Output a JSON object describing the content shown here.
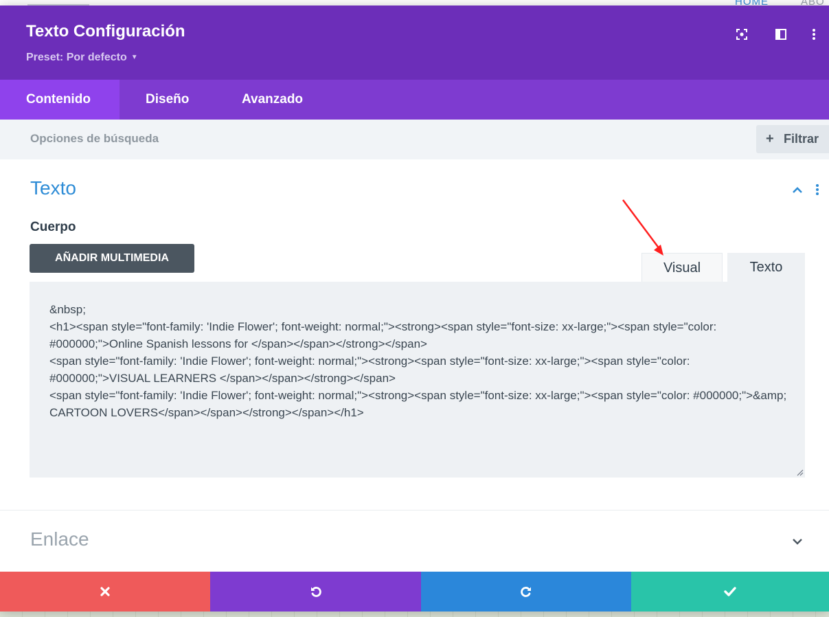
{
  "background": {
    "nav_home": "HOME",
    "nav_about": "ABO"
  },
  "header": {
    "title": "Texto Configuración",
    "preset": "Preset: Por defecto"
  },
  "tabs": [
    {
      "label": "Contenido",
      "active": true
    },
    {
      "label": "Diseño",
      "active": false
    },
    {
      "label": "Avanzado",
      "active": false
    }
  ],
  "search": {
    "placeholder": "Opciones de búsqueda",
    "filter_label": "Filtrar"
  },
  "section_texto": {
    "title": "Texto",
    "field_label": "Cuerpo",
    "media_button": "AÑADIR MULTIMEDIA",
    "editor_tabs": {
      "visual": "Visual",
      "text": "Texto"
    },
    "content": "&nbsp;\n<h1><span style=\"font-family: 'Indie Flower'; font-weight: normal;\"><strong><span style=\"font-size: xx-large;\"><span style=\"color: #000000;\">Online Spanish lessons for </span></span></strong></span>\n<span style=\"font-family: 'Indie Flower'; font-weight: normal;\"><strong><span style=\"font-size: xx-large;\"><span style=\"color: #000000;\">VISUAL LEARNERS </span></span></strong></span>\n<span style=\"font-family: 'Indie Flower'; font-weight: normal;\"><strong><span style=\"font-size: xx-large;\"><span style=\"color: #000000;\">&amp; CARTOON LOVERS</span></span></strong></span></h1>"
  },
  "section_enlace": {
    "title": "Enlace"
  },
  "footer": {
    "cancel_icon": "close-icon",
    "undo_icon": "undo-icon",
    "redo_icon": "redo-icon",
    "save_icon": "check-icon"
  },
  "colors": {
    "header": "#6c2eb9",
    "tabs": "#7e3bd0",
    "active_tab": "#8f42ec",
    "accent_blue": "#2e8cd6",
    "cancel": "#ef5a5a",
    "undo": "#7e3bd0",
    "redo": "#2b87da",
    "save": "#29c4a9",
    "annotation_arrow": "#ff1f1f"
  }
}
